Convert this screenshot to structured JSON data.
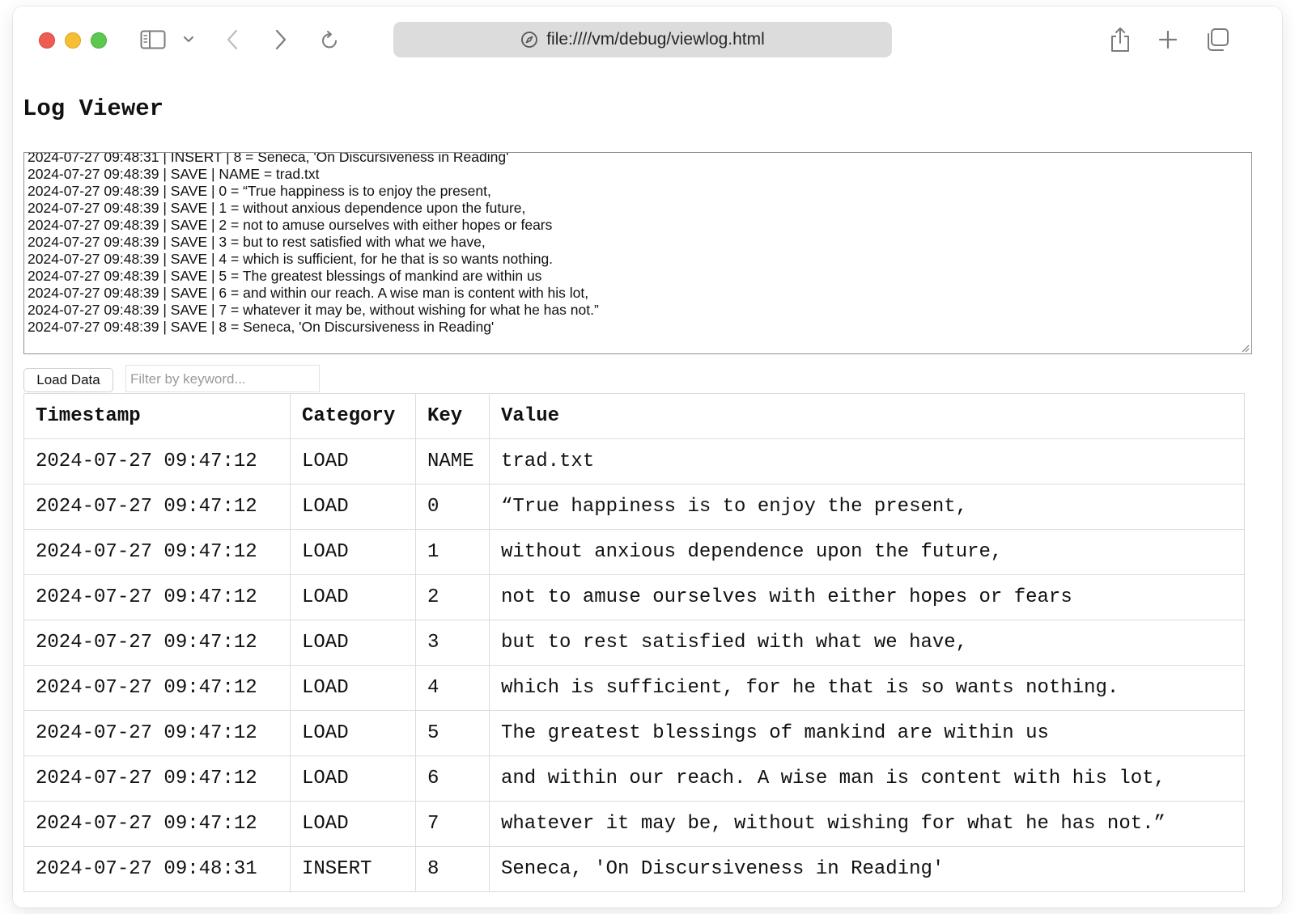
{
  "browser": {
    "url": "file:////vm/debug/viewlog.html",
    "icons": [
      "close-window",
      "minimize-window",
      "zoom-window",
      "sidebar-icon",
      "chevron-down-icon",
      "back-arrow-icon",
      "forward-arrow-icon",
      "reload-icon",
      "compass-icon",
      "share-icon",
      "plus-icon",
      "tabs-overview-icon"
    ]
  },
  "page": {
    "title": "Log Viewer",
    "load_button_label": "Load Data",
    "filter_placeholder": "Filter by keyword..."
  },
  "log_text": [
    "2024-07-27 09:48:31 | INSERT | 8 = Seneca, 'On Discursiveness in Reading'",
    "2024-07-27 09:48:39 | SAVE | NAME = trad.txt",
    "2024-07-27 09:48:39 | SAVE | 0 = “True happiness is to enjoy the present,",
    "2024-07-27 09:48:39 | SAVE | 1 = without anxious dependence upon the future,",
    "2024-07-27 09:48:39 | SAVE | 2 = not to amuse ourselves with either hopes or fears",
    "2024-07-27 09:48:39 | SAVE | 3 = but to rest satisfied with what we have,",
    "2024-07-27 09:48:39 | SAVE | 4 = which is sufficient, for he that is so wants nothing.",
    "2024-07-27 09:48:39 | SAVE | 5 = The greatest blessings of mankind are within us",
    "2024-07-27 09:48:39 | SAVE | 6 = and within our reach. A wise man is content with his lot,",
    "2024-07-27 09:48:39 | SAVE | 7 = whatever it may be, without wishing for what he has not.”",
    "2024-07-27 09:48:39 | SAVE | 8 = Seneca, 'On Discursiveness in Reading'"
  ],
  "table": {
    "headers": [
      "Timestamp",
      "Category",
      "Key",
      "Value"
    ],
    "rows": [
      [
        "2024-07-27 09:47:12",
        "LOAD",
        "NAME",
        "trad.txt"
      ],
      [
        "2024-07-27 09:47:12",
        "LOAD",
        "0",
        "“True happiness is to enjoy the present,"
      ],
      [
        "2024-07-27 09:47:12",
        "LOAD",
        "1",
        "without anxious dependence upon the future,"
      ],
      [
        "2024-07-27 09:47:12",
        "LOAD",
        "2",
        "not to amuse ourselves with either hopes or fears"
      ],
      [
        "2024-07-27 09:47:12",
        "LOAD",
        "3",
        "but to rest satisfied with what we have,"
      ],
      [
        "2024-07-27 09:47:12",
        "LOAD",
        "4",
        "which is sufficient, for he that is so wants nothing."
      ],
      [
        "2024-07-27 09:47:12",
        "LOAD",
        "5",
        "The greatest blessings of mankind are within us"
      ],
      [
        "2024-07-27 09:47:12",
        "LOAD",
        "6",
        "and within our reach. A wise man is content with his lot,"
      ],
      [
        "2024-07-27 09:47:12",
        "LOAD",
        "7",
        "whatever it may be, without wishing for what he has not.”"
      ],
      [
        "2024-07-27 09:48:31",
        "INSERT",
        "8",
        "Seneca, 'On Discursiveness in Reading'"
      ]
    ]
  }
}
